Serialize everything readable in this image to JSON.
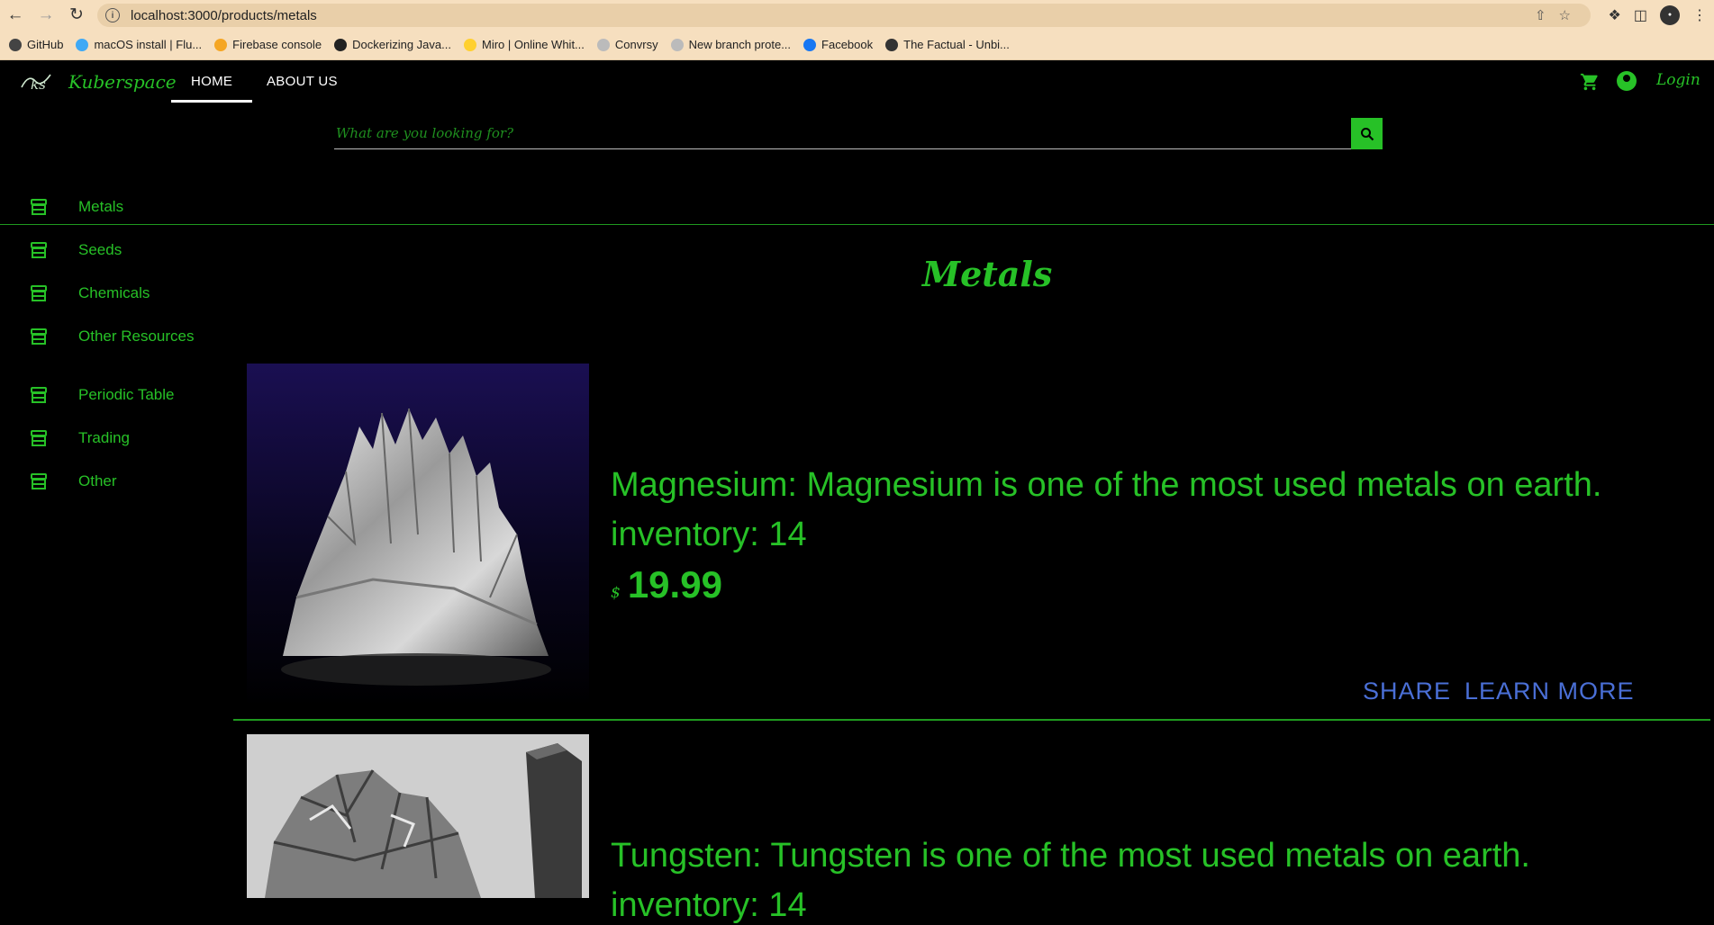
{
  "browser": {
    "url": "localhost:3000/products/metals",
    "bookmarks": [
      {
        "label": "GitHub",
        "color": "#444444"
      },
      {
        "label": "macOS install | Flu...",
        "color": "#3fa9f5"
      },
      {
        "label": "Firebase console",
        "color": "#f5a623"
      },
      {
        "label": "Dockerizing Java...",
        "color": "#222222"
      },
      {
        "label": "Miro | Online Whit...",
        "color": "#ffd02f"
      },
      {
        "label": "Convrsy",
        "color": "#bbbbbb"
      },
      {
        "label": "New branch prote...",
        "color": "#bbbbbb"
      },
      {
        "label": "Facebook",
        "color": "#1877f2"
      },
      {
        "label": "The Factual - Unbi...",
        "color": "#333333"
      }
    ]
  },
  "app": {
    "brand": "Kuberspace",
    "logo_text": "ks",
    "tabs": {
      "home": "HOME",
      "about": "ABOUT US"
    },
    "login": "Login",
    "search": {
      "placeholder": "What are you looking for?"
    },
    "accent": "#27c127"
  },
  "sidebar": {
    "items": [
      {
        "label": "Metals"
      },
      {
        "label": "Seeds"
      },
      {
        "label": "Chemicals"
      },
      {
        "label": "Other Resources"
      },
      {
        "label": "Periodic Table"
      },
      {
        "label": "Trading"
      },
      {
        "label": "Other"
      }
    ]
  },
  "main": {
    "heading": "Metals",
    "products": [
      {
        "title": "Magnesium: Magnesium is one of the most used metals on earth.",
        "inventory": "inventory: 14",
        "currency": "$",
        "price": "19.99",
        "share": "SHARE",
        "learn_more": "LEARN MORE"
      },
      {
        "title": "Tungsten: Tungsten is one of the most used metals on earth.",
        "inventory": "inventory: 14"
      }
    ]
  }
}
